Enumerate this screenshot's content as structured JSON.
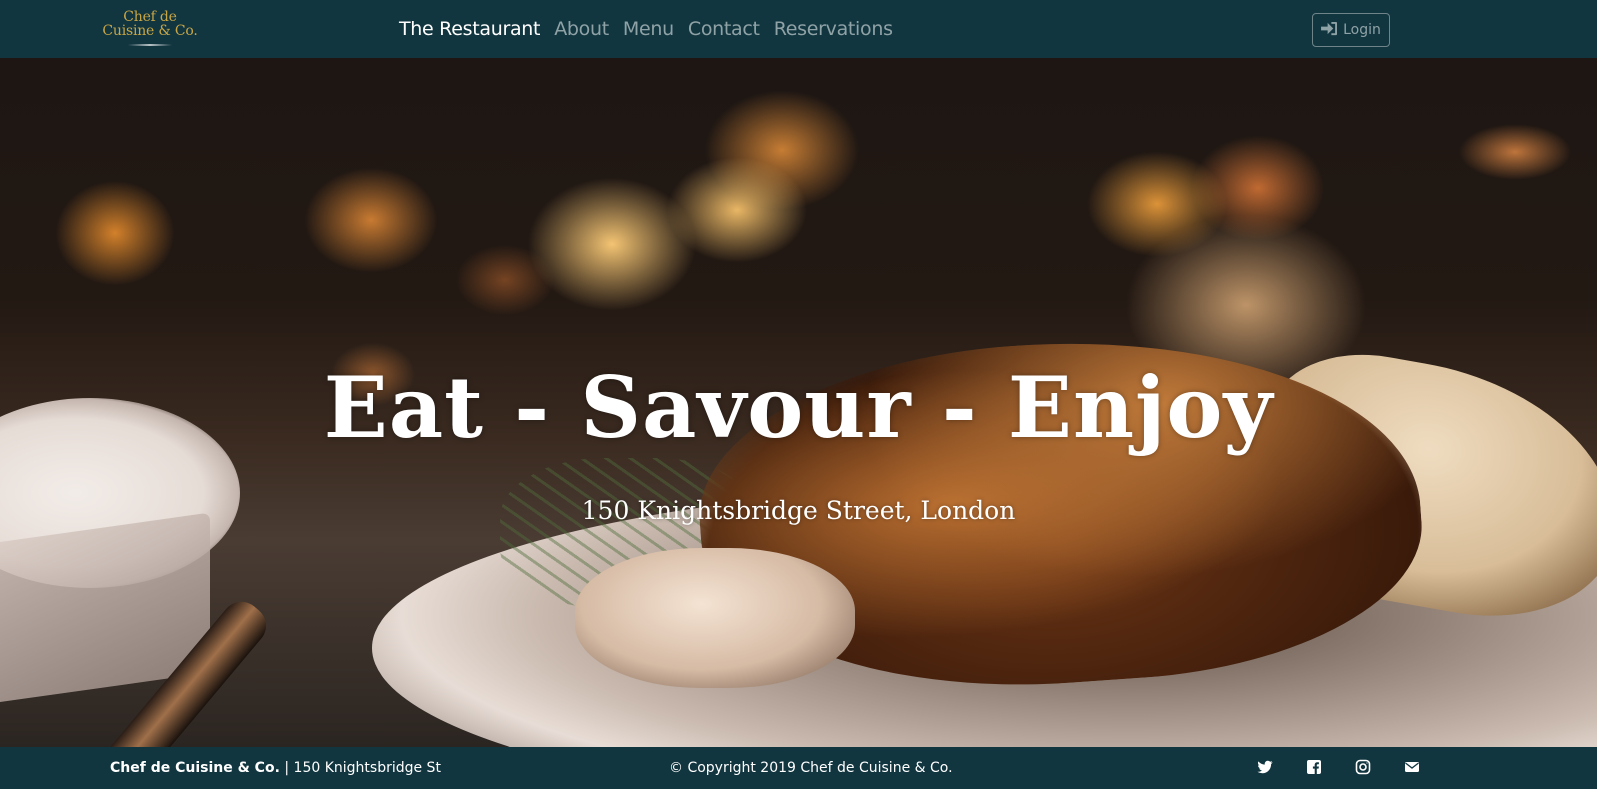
{
  "navbar": {
    "logo_line1": "Chef de",
    "logo_line2": "Cuisine & Co.",
    "links": [
      {
        "label": "The Restaurant",
        "active": true
      },
      {
        "label": "About",
        "active": false
      },
      {
        "label": "Menu",
        "active": false
      },
      {
        "label": "Contact",
        "active": false
      },
      {
        "label": "Reservations",
        "active": false
      }
    ],
    "login_label": "Login",
    "login_icon": "sign-in-icon"
  },
  "hero": {
    "title": "Eat - Savour - Enjoy",
    "subtitle": "150 Knightsbridge Street, London"
  },
  "footer": {
    "brand": "Chef de Cuisine & Co.",
    "separator": "|",
    "address": "150 Knightsbridge St",
    "copyright": "© Copyright 2019 Chef de Cuisine & Co.",
    "social_icons": [
      "twitter-icon",
      "facebook-icon",
      "instagram-icon",
      "envelope-icon"
    ]
  },
  "colors": {
    "bar_background": "#123640",
    "logo_gold": "#c9a645",
    "nav_inactive": "#8fa2a6",
    "nav_active": "#ffffff"
  }
}
